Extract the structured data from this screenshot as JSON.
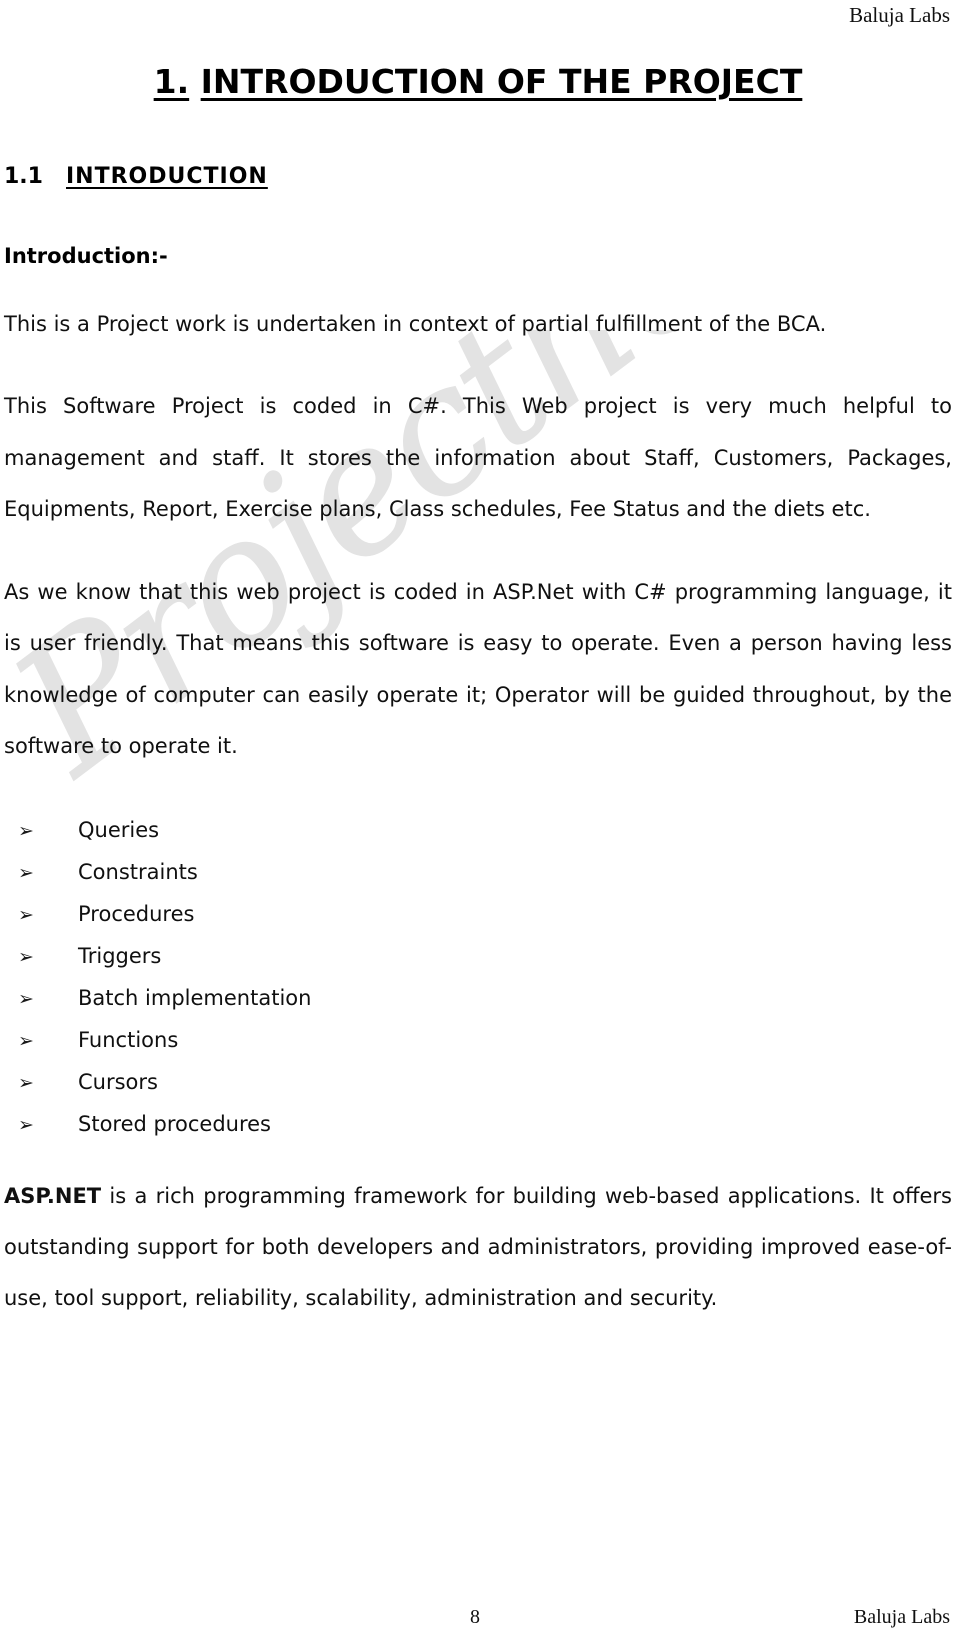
{
  "header": {
    "brand": "Baluja Labs"
  },
  "watermark": {
    "text": "Projecthelpline.in"
  },
  "title": {
    "number": "1.",
    "text": "INTRODUCTION OF THE PROJECT"
  },
  "section": {
    "number": "1.1",
    "label": "INTRODUCTION"
  },
  "subheading": "Introduction:-",
  "paragraphs": {
    "p1": "This is a Project work is undertaken in context of partial fulfillment of the BCA.",
    "p2": "This Software Project is coded in C#.  This Web  project is very much helpful to management and staff. It stores the information about Staff, Customers, Packages, Equipments, Report, Exercise plans, Class schedules, Fee Status and the diets etc.",
    "p3": "As we know that this web project is coded in ASP.Net with C# programming language, it is user friendly. That means this software is easy to operate. Even a person having less knowledge of computer can easily operate it; Operator will be guided throughout, by the software to operate it."
  },
  "list": {
    "bullet_glyph": "➢",
    "items": [
      "Queries",
      "Constraints",
      "Procedures",
      "Triggers",
      "Batch implementation",
      "Functions",
      "Cursors",
      "Stored procedures"
    ]
  },
  "closing": {
    "lead": "ASP.NET",
    "rest": " is a rich programming framework for building web-based applications. It offers outstanding support for both developers and administrators, providing improved ease-of-use, tool support, reliability, scalability, administration and security."
  },
  "footer": {
    "page_number": "8",
    "brand": "Baluja Labs"
  },
  "colors": {
    "text": "#101010",
    "watermark": "#e3e3e3",
    "background": "#ffffff"
  }
}
